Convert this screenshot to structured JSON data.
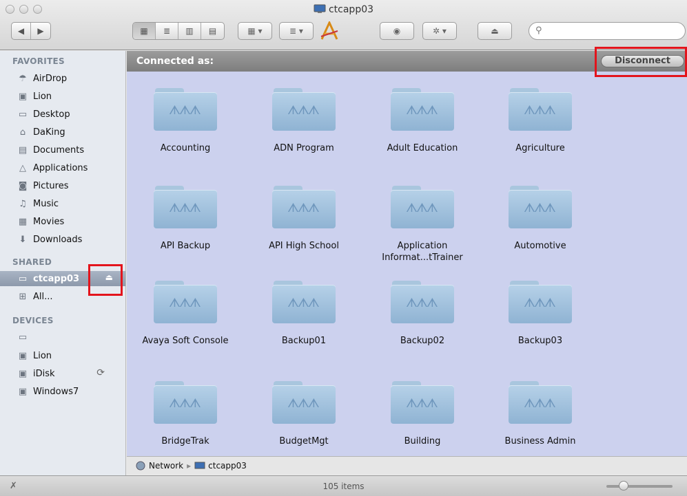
{
  "window": {
    "title": "ctcapp03"
  },
  "toolbar": {
    "back_icon": "back-icon",
    "forward_icon": "forward-icon",
    "view_modes": [
      "icon-view",
      "list-view",
      "column-view",
      "cover-flow-view"
    ],
    "search_placeholder": ""
  },
  "sidebar": {
    "favorites_title": "FAVORITES",
    "favorites": [
      {
        "label": "AirDrop",
        "icon": "airdrop-icon"
      },
      {
        "label": "Lion",
        "icon": "disk-icon"
      },
      {
        "label": "Desktop",
        "icon": "desktop-icon"
      },
      {
        "label": "DaKing",
        "icon": "home-icon"
      },
      {
        "label": "Documents",
        "icon": "documents-icon"
      },
      {
        "label": "Applications",
        "icon": "applications-icon"
      },
      {
        "label": "Pictures",
        "icon": "pictures-icon"
      },
      {
        "label": "Music",
        "icon": "music-icon"
      },
      {
        "label": "Movies",
        "icon": "movies-icon"
      },
      {
        "label": "Downloads",
        "icon": "downloads-icon"
      }
    ],
    "shared_title": "SHARED",
    "shared": [
      {
        "label": "ctcapp03",
        "icon": "computer-icon",
        "selected": true
      },
      {
        "label": "All...",
        "icon": "network-icon"
      }
    ],
    "devices_title": "DEVICES",
    "devices": [
      {
        "label": "",
        "icon": "computer-icon"
      },
      {
        "label": "Lion",
        "icon": "disk-icon"
      },
      {
        "label": "iDisk",
        "icon": "idisk-icon"
      },
      {
        "label": "Windows7",
        "icon": "disk-icon"
      }
    ]
  },
  "connection": {
    "label": "Connected as:",
    "disconnect_label": "Disconnect"
  },
  "folders": [
    "Accounting",
    "ADN Program",
    "Adult Education",
    "Agriculture",
    "API Backup",
    "API High School",
    "Application Informat...tTrainer",
    "Automotive",
    "Avaya Soft Console",
    "Backup01",
    "Backup02",
    "Backup03",
    "BridgeTrak",
    "BudgetMgt",
    "Building",
    "Business Admin"
  ],
  "pathbar": {
    "root": "Network",
    "current": "ctcapp03"
  },
  "status": {
    "count": "105 items"
  },
  "colors": {
    "highlight_box": "#e3141c",
    "content_background": "#ccd1ee"
  }
}
